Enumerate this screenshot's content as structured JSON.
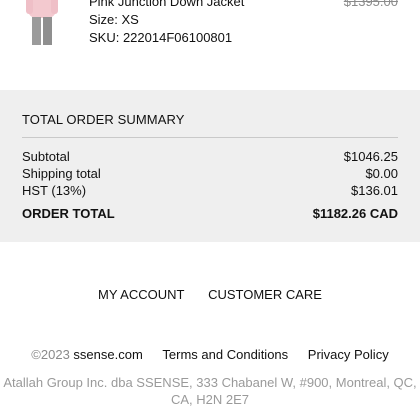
{
  "product": {
    "name": "Pink Junction Down Jacket",
    "size": "Size: XS",
    "sku": "SKU: 222014F06100801",
    "original_price": "$1395.00"
  },
  "summary": {
    "title": "TOTAL ORDER SUMMARY",
    "rows": [
      {
        "label": "Subtotal",
        "value": "$1046.25"
      },
      {
        "label": "Shipping total",
        "value": "$0.00"
      },
      {
        "label": "HST (13%)",
        "value": "$136.01"
      }
    ],
    "total": {
      "label": "ORDER TOTAL",
      "value": "$1182.26 CAD"
    }
  },
  "footer": {
    "my_account": "MY ACCOUNT",
    "customer_care": "CUSTOMER CARE",
    "copyright_symbol": "©2023",
    "site": "ssense.com",
    "terms": "Terms and Conditions",
    "privacy": "Privacy Policy",
    "address": "Atallah Group Inc. dba SSENSE, 333 Chabanel W, #900, Montreal, QC, CA, H2N 2E7"
  }
}
